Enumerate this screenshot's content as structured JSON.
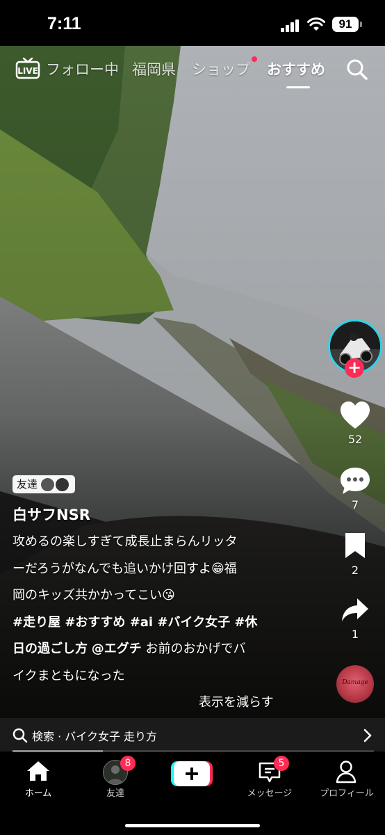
{
  "status": {
    "time": "7:11",
    "battery": "91"
  },
  "topnav": {
    "live": "LIVE",
    "tabs": [
      {
        "label": "フォロー中"
      },
      {
        "label": "福岡県"
      },
      {
        "label": "ショップ"
      },
      {
        "label": "おすすめ"
      }
    ]
  },
  "actions": {
    "likes": "52",
    "comments": "7",
    "saves": "2",
    "shares": "1"
  },
  "post": {
    "friends_badge": "友達",
    "username": "白サフNSR",
    "caption_line1": "攻めるの楽しすぎて成長止まらんリッタ",
    "caption_line2": "ーだろうがなんでも追いかけ回すよ😁福",
    "caption_line3": "岡のキッズ共かかってこい😘",
    "tags_line": "#走り屋 #おすすめ #ai #バイク女子 #休",
    "tags_line2_tag": "日の過ごし方",
    "mention": "@エグチ",
    "tail_line2": "お前のおかげでバ",
    "tail_line3": "イクまともになった",
    "show_less": "表示を減らす",
    "music_label": "Damage"
  },
  "search_suggestion": "検索 · バイク女子 走り方",
  "progress": 0.25,
  "tabbar": {
    "home": "ホーム",
    "friends": "友達",
    "friends_badge": "8",
    "inbox": "メッセージ",
    "inbox_badge": "5",
    "profile": "プロフィール"
  },
  "colors": {
    "accent": "#fe2c55",
    "cyan": "#25f4ee",
    "ring": "#2fd4e5"
  }
}
